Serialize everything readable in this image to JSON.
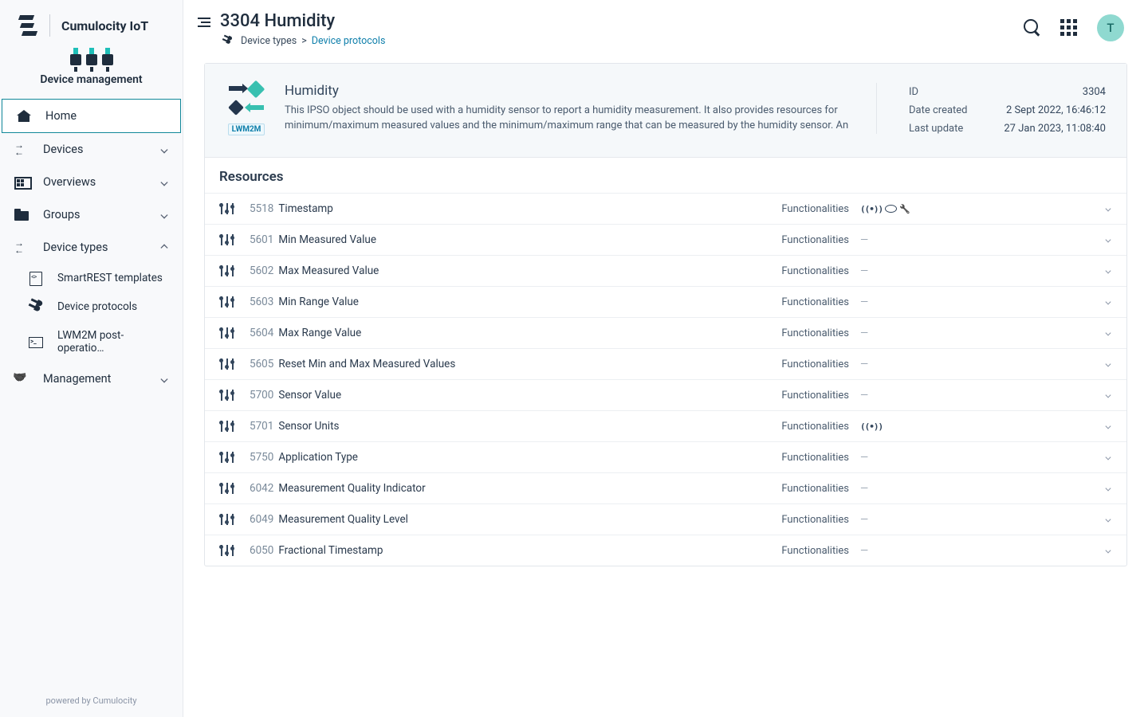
{
  "brand": {
    "name": "Cumulocity IoT"
  },
  "module": {
    "title": "Device management"
  },
  "nav": {
    "home": "Home",
    "devices": "Devices",
    "overviews": "Overviews",
    "groups": "Groups",
    "deviceTypes": "Device types",
    "smartrest": "SmartREST templates",
    "protocols": "Device protocols",
    "lwm2m": "LWM2M post-operatio…",
    "management": "Management"
  },
  "footer": "powered by Cumulocity",
  "header": {
    "title": "3304 Humidity",
    "crumbRootIcon": "device-types-icon",
    "crumb1": "Device types",
    "sep": ">",
    "crumb2": "Device protocols",
    "avatar": "T"
  },
  "protocol": {
    "badge": "LWM2M",
    "name": "Humidity",
    "desc": "This IPSO object should be used with a humidity sensor to report a humidity measurement.  It also provides resources for minimum/maximum measured values and the minimum/maximum range that can be measured by the humidity sensor. An",
    "meta": {
      "idLabel": "ID",
      "idValue": "3304",
      "createdLabel": "Date created",
      "createdValue": "2 Sept 2022, 16:46:12",
      "updatedLabel": "Last update",
      "updatedValue": "27 Jan 2023, 11:08:40"
    }
  },
  "resourcesTitle": "Resources",
  "funcLabel": "Functionalities",
  "resources": [
    {
      "code": "5518",
      "name": "Timestamp",
      "func": "bew"
    },
    {
      "code": "5601",
      "name": "Min Measured Value",
      "func": "-"
    },
    {
      "code": "5602",
      "name": "Max Measured Value",
      "func": "-"
    },
    {
      "code": "5603",
      "name": "Min Range Value",
      "func": "-"
    },
    {
      "code": "5604",
      "name": "Max Range Value",
      "func": "-"
    },
    {
      "code": "5605",
      "name": "Reset Min and Max Measured Values",
      "func": "-"
    },
    {
      "code": "5700",
      "name": "Sensor Value",
      "func": "-"
    },
    {
      "code": "5701",
      "name": "Sensor Units",
      "func": "b"
    },
    {
      "code": "5750",
      "name": "Application Type",
      "func": "-"
    },
    {
      "code": "6042",
      "name": "Measurement Quality Indicator",
      "func": "-"
    },
    {
      "code": "6049",
      "name": "Measurement Quality Level",
      "func": "-"
    },
    {
      "code": "6050",
      "name": "Fractional Timestamp",
      "func": "-"
    }
  ]
}
